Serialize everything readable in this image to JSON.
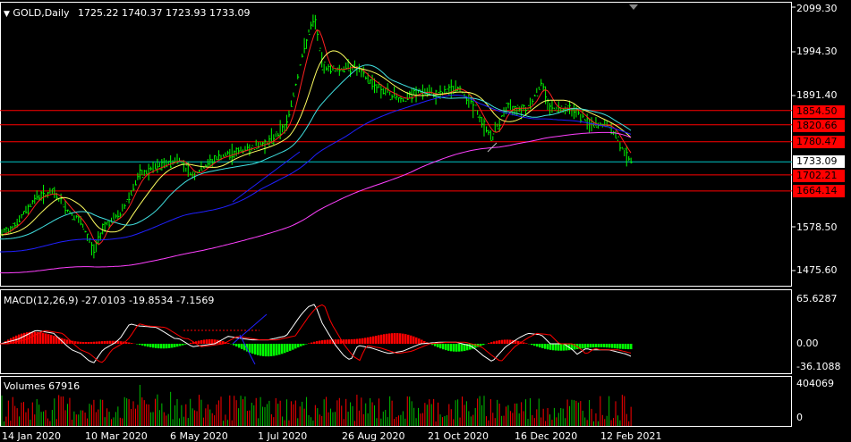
{
  "header": {
    "symbol_label": "GOLD,Daily",
    "ohlc": "1725.22 1740.37 1723.93 1733.09",
    "dropdown_icon": "triangle-down-icon"
  },
  "colors": {
    "background": "#000000",
    "frame": "#ffffff",
    "bull_candle": "#00ff00",
    "price_line": "#00c8c8",
    "support_line": "#ff0000",
    "ma_fast": "#ff2020",
    "ma_yellow": "#ffff60",
    "ma_cyan": "#40e0e0",
    "ma_blue": "#2020ff",
    "ma_magenta": "#ff40ff",
    "hist_pos": "#ff0000",
    "hist_neg": "#00ff00",
    "macd_line": "#ffffff",
    "signal_line": "#ff0000",
    "volume_bar": "#00c000",
    "volume_bar_alt": "#ff0000"
  },
  "price_axis": [
    "2099.30",
    "1994.30",
    "1891.40",
    "1578.50",
    "1475.60"
  ],
  "level_badges": [
    {
      "text": "1854.50",
      "level": 1854.5,
      "bg": "#ff0000",
      "color": "#000000"
    },
    {
      "text": "1820.66",
      "level": 1820.66,
      "bg": "#ff0000",
      "color": "#000000"
    },
    {
      "text": "1780.47",
      "level": 1780.47,
      "bg": "#ff0000",
      "color": "#000000"
    },
    {
      "text": "1733.09",
      "level": 1733.09,
      "bg": "#ffffff",
      "color": "#000000"
    },
    {
      "text": "1702.21",
      "level": 1702.21,
      "bg": "#ff0000",
      "color": "#000000"
    },
    {
      "text": "1664.14",
      "level": 1664.14,
      "bg": "#ff0000",
      "color": "#000000"
    }
  ],
  "macd": {
    "label": "MACD(12,26,9) -27.0103 -19.8534 -7.1569",
    "axis": [
      "65.6287",
      "0.00",
      "-36.1088"
    ]
  },
  "volumes": {
    "label": "Volumes 67916",
    "axis": [
      "404069",
      "0"
    ]
  },
  "date_axis": [
    "14 Jan 2020",
    "10 Mar 2020",
    "6 May 2020",
    "1 Jul 2020",
    "26 Aug 2020",
    "21 Oct 2020",
    "16 Dec 2020",
    "12 Feb 2021"
  ]
}
